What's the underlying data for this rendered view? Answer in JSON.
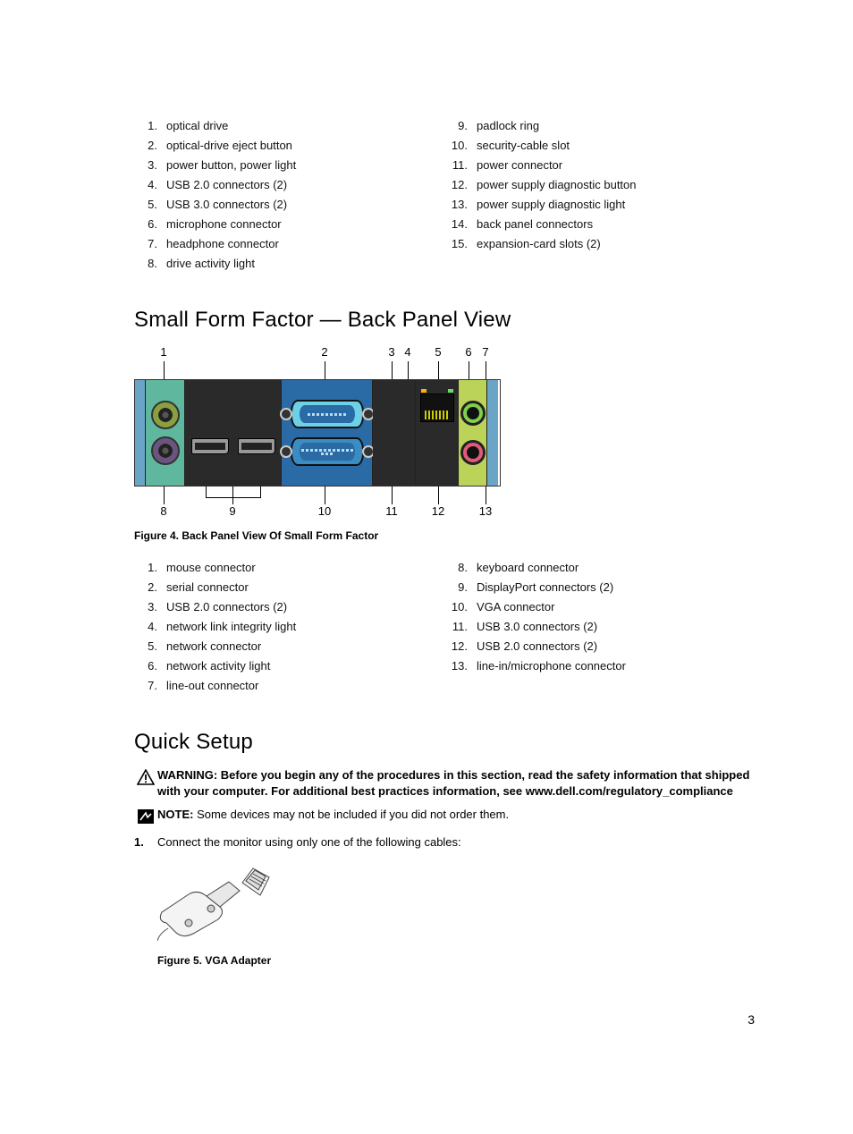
{
  "top_list": {
    "left": [
      "optical drive",
      "optical-drive eject button",
      "power button, power light",
      "USB 2.0 connectors (2)",
      "USB 3.0 connectors (2)",
      "microphone connector",
      "headphone connector",
      "drive activity light"
    ],
    "right": [
      "padlock ring",
      "security-cable slot",
      "power connector",
      "power supply diagnostic button",
      "power supply diagnostic light",
      "back panel connectors",
      "expansion-card slots (2)"
    ],
    "right_start": 9
  },
  "heading_sff": "Small Form Factor — Back Panel View",
  "panel": {
    "top_callouts": [
      1,
      2,
      3,
      4,
      5,
      6,
      7
    ],
    "bottom_callouts": [
      8,
      9,
      10,
      11,
      12,
      13
    ]
  },
  "figure4_caption": "Figure 4. Back Panel View Of Small Form Factor",
  "back_panel_list": {
    "left": [
      "mouse connector",
      "serial connector",
      "USB 2.0 connectors (2)",
      "network link integrity light",
      "network connector",
      "network activity light",
      "line-out connector"
    ],
    "right": [
      "keyboard connector",
      "DisplayPort connectors (2)",
      "VGA connector",
      "USB 3.0 connectors (2)",
      "USB 2.0 connectors (2)",
      "line-in/microphone connector"
    ],
    "right_start": 8
  },
  "heading_quick": "Quick Setup",
  "warning": {
    "label": "WARNING:",
    "text": "Before you begin any of the procedures in this section, read the safety information that shipped with your computer. For additional best practices information, see www.dell.com/regulatory_compliance"
  },
  "note": {
    "label": "NOTE:",
    "text": "Some devices may not be included if you did not order them."
  },
  "step1": {
    "num": "1.",
    "text": "Connect the monitor using only one of the following cables:"
  },
  "figure5_caption": "Figure 5. VGA Adapter",
  "page_number": "3"
}
